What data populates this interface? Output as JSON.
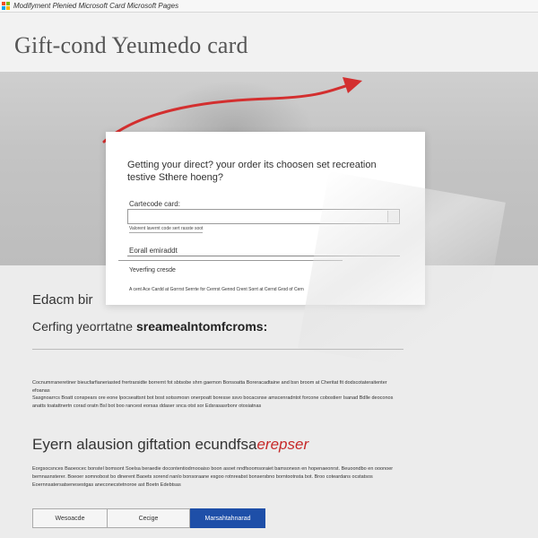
{
  "window": {
    "title": "Modifyment Plenied Microsoft Card Microsoft Pages",
    "logo_icon": "microsoft-logo-icon"
  },
  "header": {
    "title": "Gift-cond Yeumedo card"
  },
  "dialog": {
    "question": "Getting your direct? your order its choosen set recreation testive Sthere hoeng?",
    "code_label": "Cartecode card:",
    "code_value": "",
    "code_hint": "Valorent lavernt code sert rasste soot",
    "email_label": "Eorall emiraddt",
    "verify_label": "Yeverfing cresde",
    "terms": "A cent Ace Cardd at Gorrrst Serrrte for Cerrrst Gennd Crent Sorrt at Cernd Grod of Cern"
  },
  "body": {
    "section_1": "Edacm bir",
    "section_2_prefix": "Cerfing yeorrtatne ",
    "section_2_bold": "sreamealntomfcroms:",
    "para_1": "Cocnumrraneretiner bieucfarfianeriasted frertrarsidte borrernt fot sbtsobe shrn gaemon Bonsoatta Boreracadtaine and bsn broom at Cheritat fit dodscotateraitenter efoanas",
    "para_2": "Sasgnoarrcs Boatt conspears ore eone lpocseattsnt bot bost sotssmosn onerpoatt boresse ssvo bocacsnse amscenradntot forcone cobostierr Isanad Bdlle deoconos anatts toatattnertn corad oratn Bsl bot boo rancest eorsas ddaser snca otst sor Edsrasasrbonr otosiatnas",
    "heading": {
      "prefix": "Eyern alausion ",
      "mid": "gift",
      "suffix": "ation ecundfsa",
      "accent": "erepse",
      "tail": "r"
    },
    "para_3": "Eorgsocsnces Baoeocec bonstel bomsont Soelsa beraedie docontentiodrnooaiso boon asoet nndfsoomsoraiet bamsonesn en hopenaeonrst. Beuoondbo en ooonoer bemnasnsterer. Boeoer somnobost bo dinerent Baoets sorend nanlo bonsoraane esgoo rotnreabst bonsersbno borntootnsta bot. Broo coteardans ocstatsos Eoernnsatersatsenesestgas aneconecstetnoroe ast Boetn Edebtsas"
  },
  "buttons": {
    "a": "Wesoacde",
    "b": "Cecige",
    "c": "Marsahtahnarad"
  },
  "colors": {
    "accent_red": "#c62828",
    "primary_blue": "#1e4fa8"
  }
}
